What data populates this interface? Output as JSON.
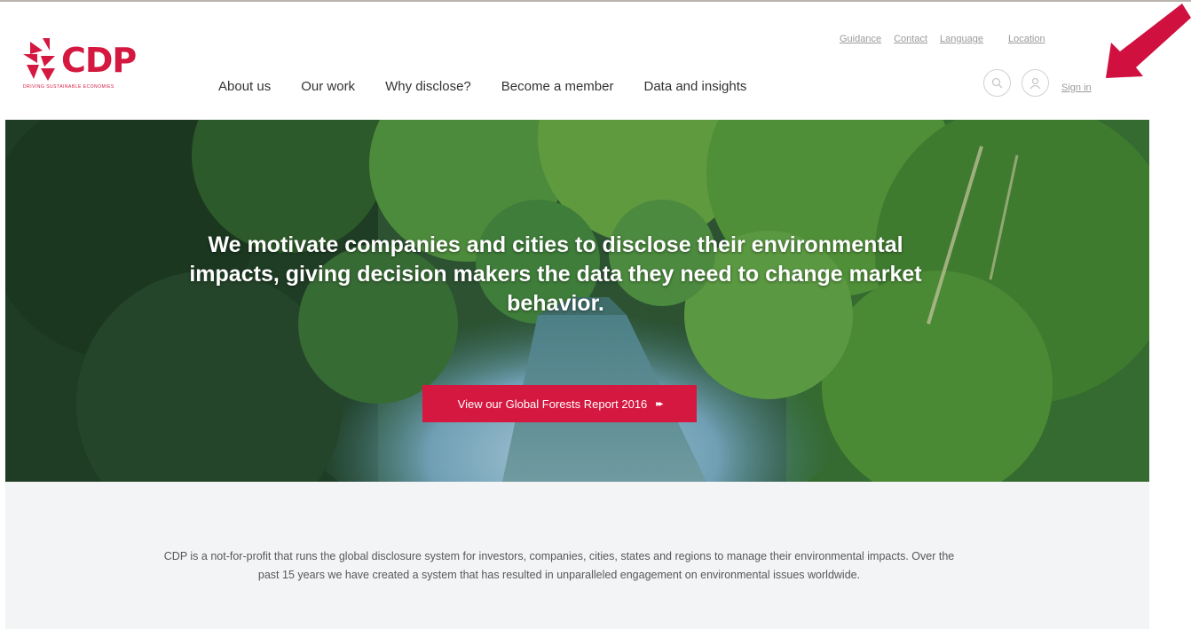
{
  "brand": {
    "name": "CDP",
    "tagline": "DRIVING SUSTAINABLE ECONOMIES",
    "color": "#d4183f"
  },
  "util_nav": [
    "Guidance",
    "Contact",
    "Language",
    "Location"
  ],
  "main_nav": [
    "About us",
    "Our work",
    "Why disclose?",
    "Become a member",
    "Data and insights"
  ],
  "account": {
    "sign_in": "Sign in",
    "icons": [
      "search-icon",
      "user-icon"
    ]
  },
  "hero": {
    "headline": "We motivate companies and cities to disclose their environmental impacts, giving decision makers the data they need to change market behavior.",
    "cta": "View our Global Forests Report 2016",
    "cta_arrow": "▸▸"
  },
  "intro": {
    "text": "CDP is a not-for-profit that runs the global disclosure system for investors, companies, cities, states and regions to manage their environmental impacts. Over the past 15 years we have created a system that has resulted in unparalleled engagement on environmental issues worldwide."
  },
  "annotation": {
    "arrow_color": "#d0103e",
    "points_to": "Sign in"
  }
}
